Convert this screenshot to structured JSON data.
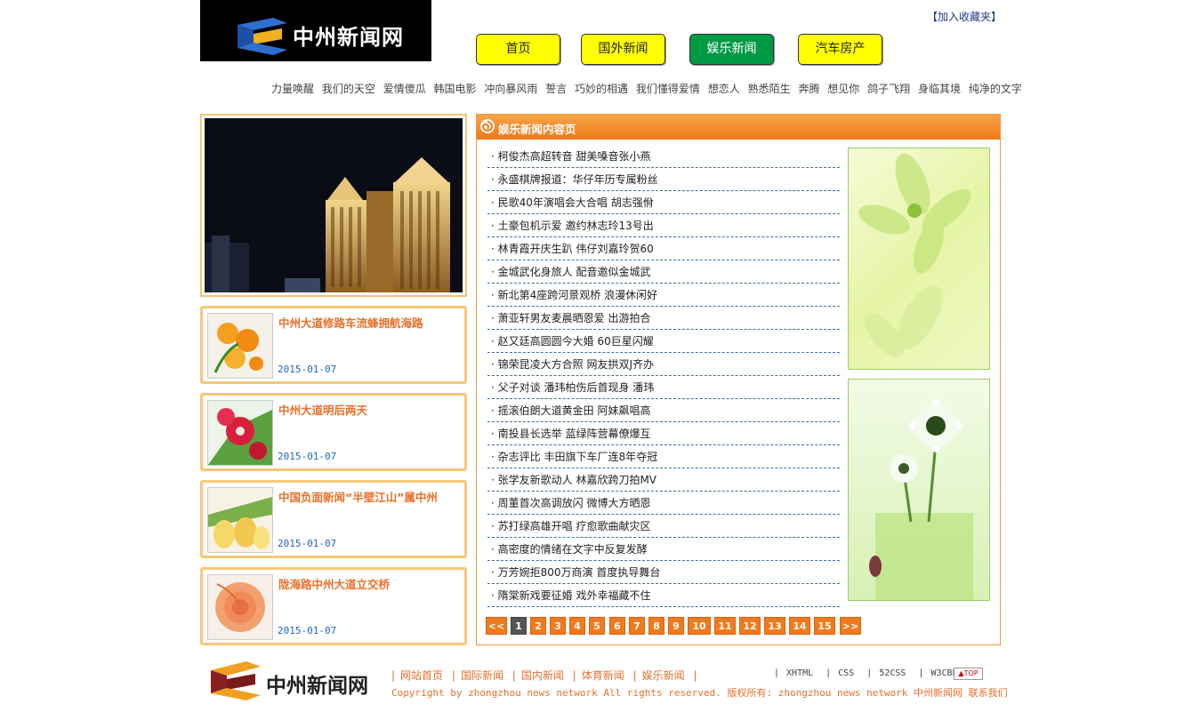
{
  "header": {
    "logo_text": "中州新闻网",
    "favorite_link": "【加入收藏夹】",
    "nav": [
      "首页",
      "国外新闻",
      "娱乐新闻",
      "汽车房产"
    ],
    "active_nav": "娱乐新闻"
  },
  "tags": [
    "力量唤醒",
    "我们的天空",
    "爱情傻瓜",
    "韩国电影",
    "冲向暴风雨",
    "誓言",
    "巧妙的相遇",
    "我们懂得爱情",
    "想恋人",
    "熟悉陌生",
    "奔腾",
    "想见你",
    "鸽子飞翔",
    "身临其境",
    "纯净的文字"
  ],
  "left_cards": [
    {
      "title": "中州大道修路车流蜂拥航海路",
      "date": "2015-01-07"
    },
    {
      "title": "中州大道明后两天",
      "date": "2015-01-07"
    },
    {
      "title": "中国负面新闻“半壁江山”属中州",
      "date": "2015-01-07"
    },
    {
      "title": "陇海路中州大道立交桥",
      "date": "2015-01-07"
    }
  ],
  "panel": {
    "title": "娱乐新闻内容页",
    "items": [
      "柯俊杰高超转音 甜美嗓音张小燕",
      "永盛棋牌报道：华仔年历专属粉丝",
      "民歌40年演唱会大合唱 胡志强佾",
      "土豪包机示爱 邀约林志玲13号出",
      "林青霞开庆生趴 伟仔刘嘉玲贺60",
      "金城武化身旅人 配音邀似金城武",
      "新北第4座跨河景观桥 浪漫休闲好",
      "萧亚轩男友麦晨晒恩爱 出游拍合",
      "赵又廷高圆圆今大婚 60巨星闪耀",
      "锦荣昆凌大方合照 网友拱双J齐办",
      "父子对谈 潘玮柏伤后首现身 潘玮",
      "摇滚伯朗大道黄金田 阿妹飙唱高",
      "南投县长选举 蓝绿阵营幕僚爆互",
      "杂志评比 丰田旗下车厂连8年夺冠",
      "张学友新歌动人 林嘉欣跨刀拍MV",
      "周董首次高调放闪 微博大方晒恩",
      "苏打绿高雄开唱 疗愈歌曲献灾区",
      "高密度的情绪在文字中反复发酵",
      "万芳婉拒800万商演 首度执导舞台",
      "隋棠新戏要征婚 戏外幸福藏不住"
    ],
    "pager": {
      "prev": "<<",
      "pages": [
        "1",
        "2",
        "3",
        "4",
        "5",
        "6",
        "7",
        "8",
        "9",
        "10",
        "11",
        "12",
        "13",
        "14",
        "15"
      ],
      "current": "1",
      "next": ">>"
    }
  },
  "footer": {
    "logo_text": "中州新闻网",
    "links": [
      "网站首页",
      "国际新闻",
      "国内新闻",
      "体育新闻",
      "娱乐新闻"
    ],
    "badges": [
      "XHTML",
      "CSS",
      "52CSS",
      "W3CBBS"
    ],
    "top": "TOP",
    "copyright": "Copyright by zhongzhou news network All rights reserved. 版权所有: zhongzhou news network 中州新闻网 联系我们"
  },
  "colors": {
    "nav_yellow": "#ffff00",
    "nav_active": "#009944",
    "accent_orange": "#f07a1e",
    "card_border": "#f7c877",
    "dashed_line": "#3a6fb0"
  }
}
